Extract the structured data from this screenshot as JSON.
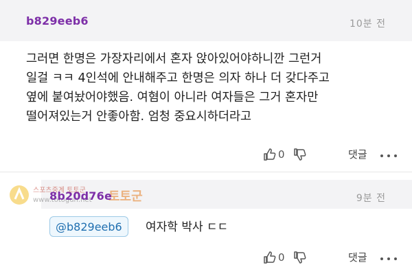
{
  "comment": {
    "username": "b829eeb6",
    "time": "10분 전",
    "body": "그러면 한명은 가장자리에서 혼자 앉아있어야하니깐 그런거\n일걸 ㅋㅋ 4인석에 안내해주고 한명은 의자 하나 더 갖다주고\n옆에 붙여놨어야했음. 여혐이 아니라 여자들은 그거 혼자만\n떨어져있는거 안좋아함. 엄청 중요시하더라고",
    "like_count": "0",
    "reply_label": "댓글"
  },
  "reply": {
    "username": "8b20d76e",
    "time": "9분 전",
    "mention": "@b829eeb6",
    "body": "여자학 박사 ㄷㄷ",
    "like_count": "0",
    "reply_label": "댓글"
  },
  "watermark": {
    "text_top": "스포츠중계 토토군",
    "text_bottom": "www.totogun.net",
    "logo_text": "토토군"
  },
  "icons": {
    "like": "thumbs-up-icon",
    "dislike": "thumbs-down-icon",
    "more": "more-dots-icon"
  },
  "colors": {
    "username": "#7d2fa8",
    "header_bg": "#f3f3f5",
    "mention_border": "#9cc9e6",
    "mention_text": "#1f6fb0"
  }
}
